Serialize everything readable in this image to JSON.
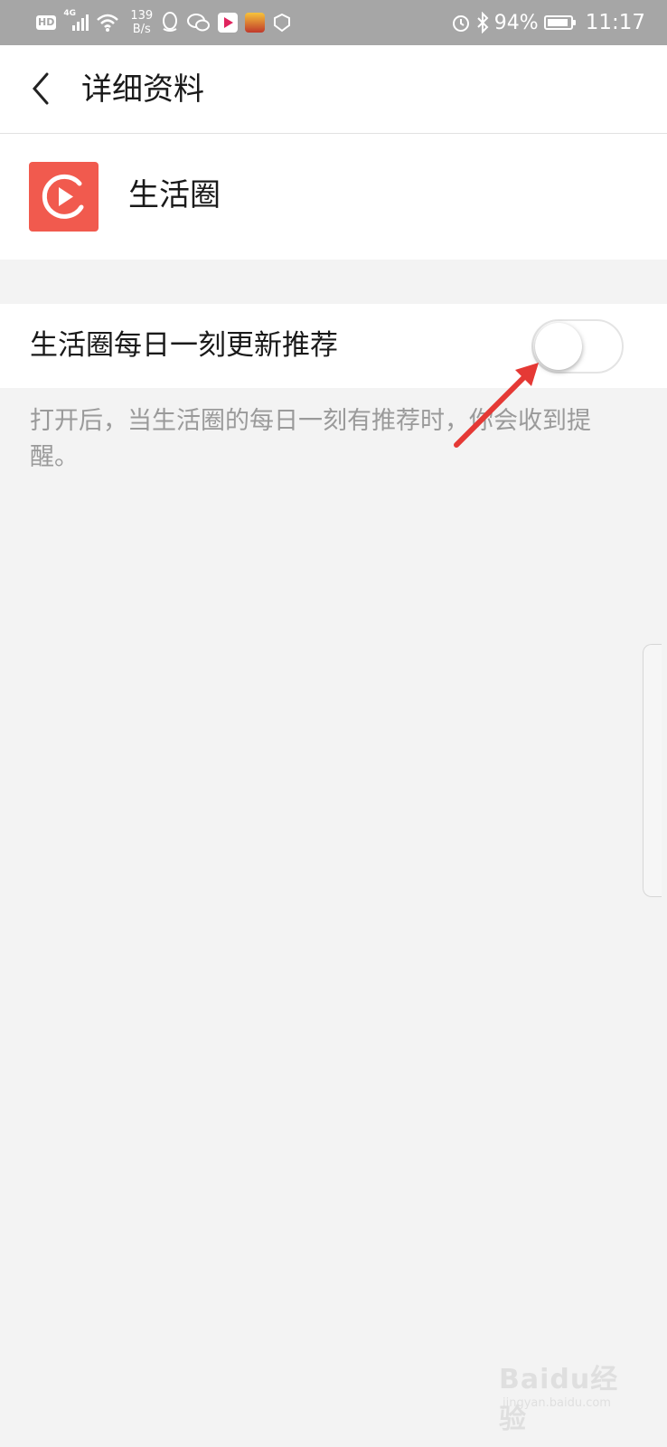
{
  "status_bar": {
    "hd_badge": "HD",
    "signal_label": "4G",
    "net_speed_value": "139",
    "net_speed_unit": "B/s",
    "battery_percent": "94%",
    "battery_level": 0.94,
    "time": "11:17",
    "icons": [
      "hd-icon",
      "signal-4g-icon",
      "wifi-icon",
      "qq-icon",
      "wechat-icon",
      "video-app-icon",
      "game-app-icon",
      "shield-app-icon",
      "alarm-icon",
      "bluetooth-icon",
      "battery-icon"
    ]
  },
  "header": {
    "title": "详细资料",
    "back_icon": "chevron-left-icon"
  },
  "profile": {
    "name": "生活圈",
    "logo_color": "#f15a4e"
  },
  "setting": {
    "label": "生活圈每日一刻更新推荐",
    "toggle_on": false,
    "hint": "打开后，当生活圈的每日一刻有推荐时，你会收到提醒。"
  },
  "annotation": {
    "arrow_color": "#e53935"
  },
  "watermark": {
    "text": "Baidu经验",
    "subtext": "jingyan.baidu.com"
  }
}
